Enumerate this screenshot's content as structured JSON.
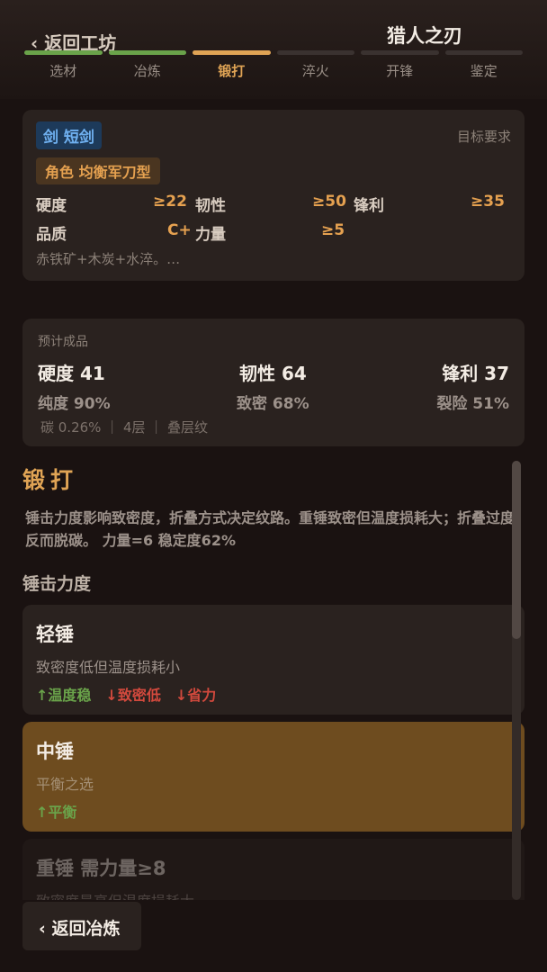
{
  "header": {
    "back_label": "‹ 返回工坊",
    "title": "猎人之刃"
  },
  "steps": [
    "选材",
    "冶炼",
    "锻打",
    "淬火",
    "开锋",
    "鉴定"
  ],
  "requirement": {
    "weapon_tag": "剑 短剑",
    "target_label": "目标要求",
    "role_tag": "角色 均衡军刀型",
    "hardness_label": "硬度",
    "hardness_val": "≥22",
    "toughness_label": "韧性",
    "toughness_val": "≥50",
    "sharp_label": "锋利",
    "sharp_val": "≥35",
    "quality_label": "品质",
    "quality_val": "C+",
    "strength_label": "力量",
    "strength_val": "≥5",
    "note": "赤铁矿+木炭+水淬。…"
  },
  "prediction": {
    "label": "预计成品",
    "hardness": "硬度 41",
    "toughness": "韧性 64",
    "sharp": "锋利 37",
    "purity": "纯度 90%",
    "density": "致密 68%",
    "crack": "裂险 51%",
    "details": "碳 0.26% ｜ 4层 ｜ 叠层纹"
  },
  "section": {
    "title": "锻打",
    "desc": "锤击力度影响致密度，折叠方式决定纹路。重锤致密但温度损耗大；折叠过度反而脱碳。 力量=6 稳定度62%",
    "sub_title": "锤击力度"
  },
  "options": [
    {
      "name": "轻锤",
      "desc": "致密度低但温度损耗小",
      "fx": [
        {
          "t": "↑温度稳",
          "k": "up"
        },
        {
          "t": "↓致密低",
          "k": "down"
        },
        {
          "t": "↓省力",
          "k": "down"
        }
      ]
    },
    {
      "name": "中锤",
      "desc": "平衡之选",
      "fx": [
        {
          "t": "↑平衡",
          "k": "up"
        }
      ]
    },
    {
      "name": "重锤 需力量≥8",
      "desc": "致密度最高但温度损耗大",
      "fx": []
    }
  ],
  "footer": {
    "back_label": "‹ 返回冶炼"
  },
  "colors": {
    "accent": "#e0a455",
    "done": "#6aa34a",
    "selected": "#6e4c1f",
    "negative": "#d2493d"
  }
}
